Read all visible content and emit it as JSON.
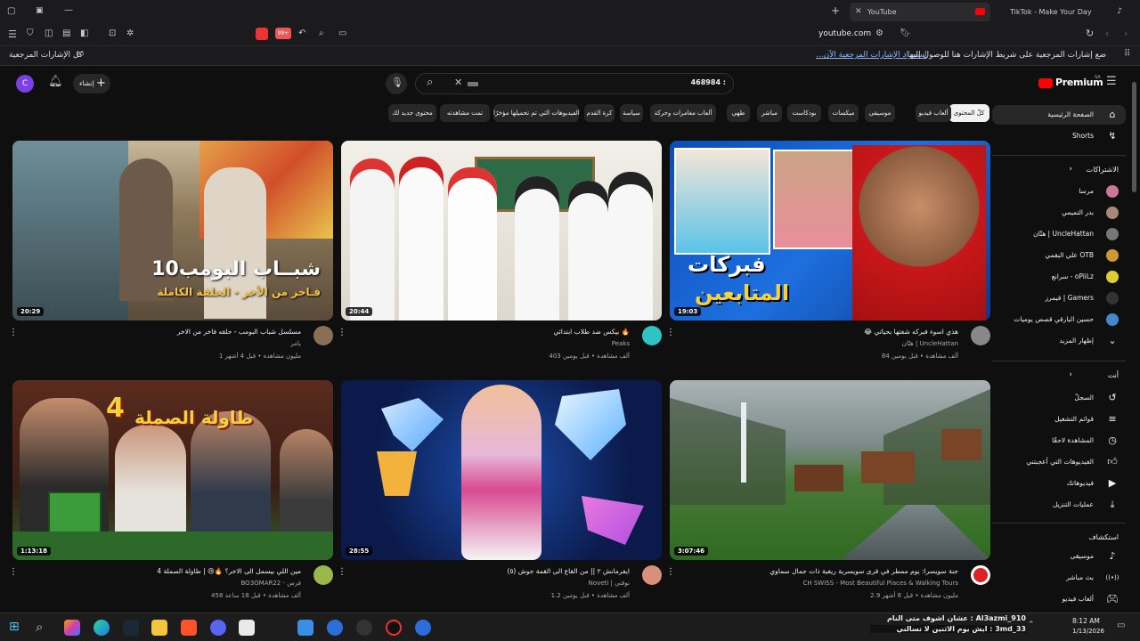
{
  "browser": {
    "tabs": [
      {
        "label": "YouTube",
        "active": true
      },
      {
        "label": "TikTok - Make Your Day",
        "active": false
      }
    ],
    "address": "youtube.com",
    "bookmark_hint": "ضع إشارات المرجعية على شريط الإشارات هنا للوصول إليها بسرعة.",
    "bookmark_import": "استيراد الإشارات المرجعية الآن...",
    "bookmark_all": "كل الإشارات المرجعية",
    "badge_count": "99+"
  },
  "youtube": {
    "brand": "Premium",
    "brand_region": "SA",
    "search_value": "468984 :",
    "create_label": "إنشاء",
    "avatar_letter": "C",
    "chips": [
      "كلّ المحتوى",
      "ألعاب فيديو",
      "موسيقى",
      "ميكسات",
      "بودكاست",
      "مباشر",
      "طهي",
      "ألعاب مغامرات وحركة",
      "سياسة",
      "كرة القدم",
      "الفيديوهات التي تم تحميلها مؤخرًا",
      "تمت مشاهدته",
      "محتوى جديد لك"
    ],
    "videos": [
      {
        "title": "مسلسل شباب البومب - حلقه فاخر من الاخر",
        "channel": "يامر",
        "meta": "1 مليون مشاهدة • قبل 4 أشهر",
        "duration": "20:29",
        "thumb_text1": "شبــاب البومب10",
        "thumb_text2": "فـاخر من الأخر - الحلقة الكاملة"
      },
      {
        "title": "بيكس ضد طلاب ابتدائي 🔥",
        "channel": "Peaks",
        "meta": "403 ألف مشاهدة • قبل يومين",
        "duration": "20:44",
        "thumb_text1": "",
        "thumb_text2": ""
      },
      {
        "title": "😂 هذي اسوء فبركه شفتها بحياتي",
        "channel": "هتّان | UncleHattan",
        "meta": "84 ألف مشاهدة • قبل يومين",
        "duration": "19:03",
        "thumb_text1": "فبركات",
        "thumb_text2": "المتابعين"
      },
      {
        "title": "مين اللي بيسمل الى الاخر؟ 🔥😢 | طاولة الصملة 4",
        "channel": "BO3OMAR22 - فرس",
        "meta": "458 ألف مشاهدة • قبل 18 ساعة",
        "duration": "1:13:18",
        "thumb_text1": "طاولة الصملة",
        "thumb_text2": "4"
      },
      {
        "title": "ايفرمانش ٢ || من القاع الى القمة جوش (٥)",
        "channel": "Noveti | نوفتي",
        "meta": "1.2 ألف مشاهدة • قبل يومين",
        "duration": "28:55",
        "thumb_text1": "",
        "thumb_text2": ""
      },
      {
        "title": "جنة سويسرا: يوم ممطر في قرى سويسرية ريفية ذات جمال سماوي",
        "channel": "CH SWISS - Most Beautiful Places & Walking Tours",
        "meta": "2.9 مليون مشاهدة • قبل 8 أشهر",
        "duration": "3:07:46",
        "thumb_text1": "",
        "thumb_text2": ""
      }
    ],
    "sidebar": {
      "top": [
        {
          "label": "الصفحة الرئيسية",
          "icon": "home-icon",
          "active": true
        },
        {
          "label": "Shorts",
          "icon": "shorts-icon",
          "active": false
        }
      ],
      "subs_header": "الاشتراكات",
      "subs": [
        {
          "label": "مرسا",
          "color": "#c79"
        },
        {
          "label": "بدر التميمي",
          "color": "#a87"
        },
        {
          "label": "هتّان | UncleHattan",
          "color": "#777"
        },
        {
          "label": "علي البقمي OTB",
          "color": "#c93"
        },
        {
          "label": "سرانع - oPiiLz",
          "color": "#dc3"
        },
        {
          "label": "قيمرز | Gamers",
          "color": "#333"
        },
        {
          "label": "حسين البارقي قصص يوميات",
          "color": "#48c"
        },
        {
          "label": "إظهار المزيد",
          "color": ""
        }
      ],
      "you_header": "أنت",
      "you": [
        {
          "label": "السجلّ",
          "icon": "history-icon"
        },
        {
          "label": "قوائم التشغيل",
          "icon": "playlist-icon"
        },
        {
          "label": "المشاهدة لاحقًا",
          "icon": "clock-icon"
        },
        {
          "label": "الفيديوهات التي أعجبتني",
          "icon": "like-icon"
        },
        {
          "label": "فيديوهاتك",
          "icon": "video-icon"
        },
        {
          "label": "عمليات التنزيل",
          "icon": "download-icon"
        }
      ],
      "explore_header": "استكشاف",
      "explore": [
        {
          "label": "موسيقى",
          "icon": "music-icon"
        },
        {
          "label": "بث مباشر",
          "icon": "live-icon"
        },
        {
          "label": "ألعاب فيديو",
          "icon": "gaming-icon"
        }
      ]
    }
  },
  "taskbar": {
    "chat_line1": "Al3azmi_910 : عشان اشوف متى النام",
    "chat_line2": "3md_33 : ايش يوم الاثنين لا تسالني",
    "time": "8:12 AM",
    "date": "1/13/2026"
  }
}
